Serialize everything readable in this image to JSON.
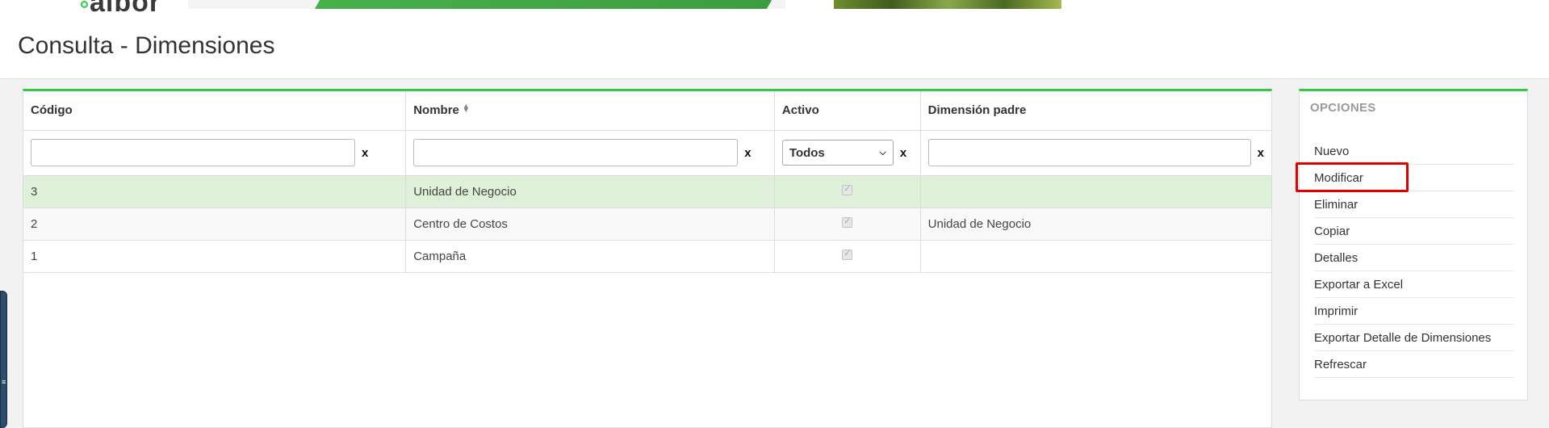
{
  "brand": {
    "logo_text": "albor"
  },
  "header": {
    "title": "Consulta - Dimensiones"
  },
  "grid": {
    "columns": [
      "Código",
      "Nombre",
      "Activo",
      "Dimensión padre"
    ],
    "filters": {
      "codigo": "",
      "nombre": "",
      "activo_selected": "Todos",
      "dimension_padre": "",
      "clear_label": "x"
    },
    "rows": [
      {
        "codigo": "3",
        "nombre": "Unidad de Negocio",
        "activo": true,
        "dimension_padre": ""
      },
      {
        "codigo": "2",
        "nombre": "Centro de Costos",
        "activo": true,
        "dimension_padre": "Unidad de Negocio"
      },
      {
        "codigo": "1",
        "nombre": "Campaña",
        "activo": true,
        "dimension_padre": ""
      }
    ]
  },
  "options": {
    "title": "OPCIONES",
    "items": [
      "Nuevo",
      "Modificar",
      "Eliminar",
      "Copiar",
      "Detalles",
      "Exportar a Excel",
      "Imprimir",
      "Exportar Detalle de Dimensiones",
      "Refrescar"
    ],
    "highlighted_item": "Modificar"
  },
  "colors": {
    "accent": "#2ecc40",
    "selected_row": "#dff0d8",
    "highlight": "#e00000"
  }
}
